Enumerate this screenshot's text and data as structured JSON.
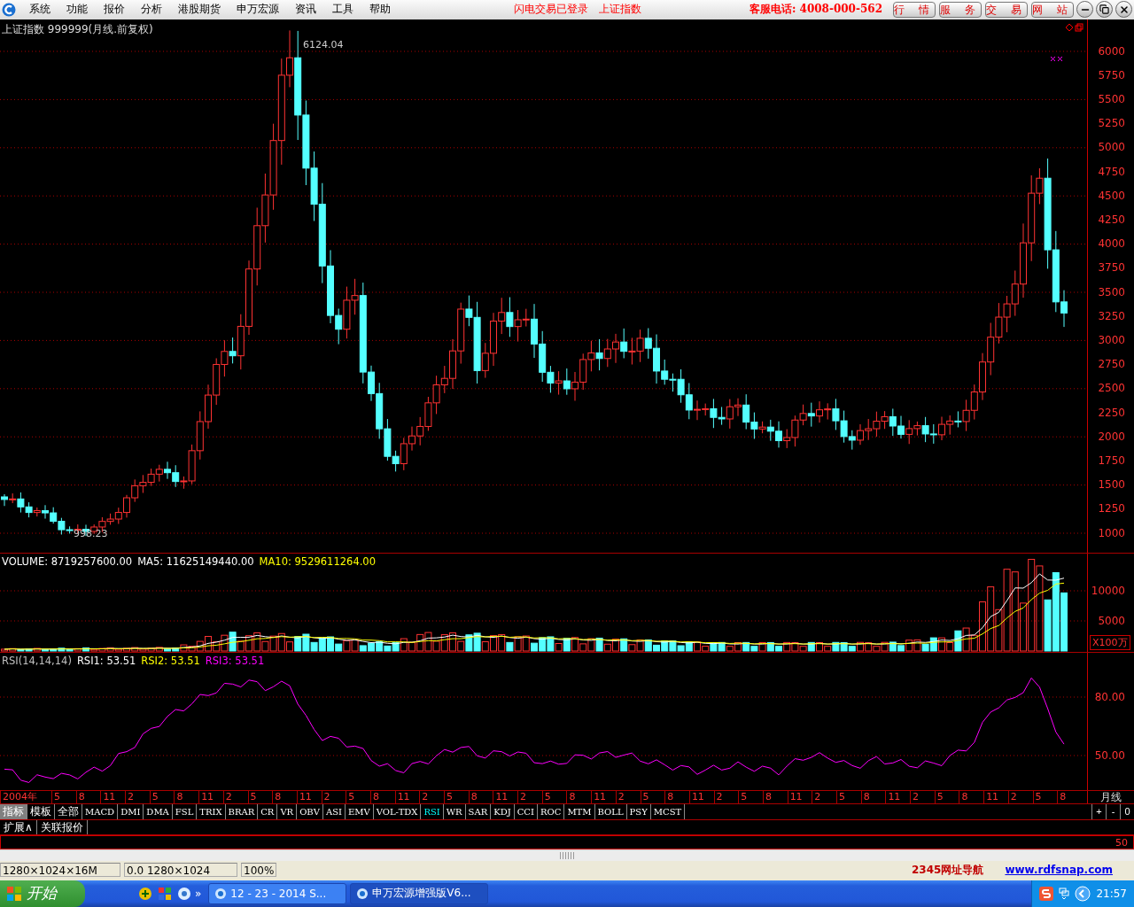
{
  "menu_bar": {
    "items": [
      "系统",
      "功能",
      "报价",
      "分析",
      "港股期货",
      "申万宏源",
      "资讯",
      "工具",
      "帮助"
    ],
    "login_status": "闪电交易已登录",
    "index_name": "上证指数",
    "hotline": "客服电话: 4008-000-562",
    "buttons": [
      "行 情",
      "服 务",
      "交 易",
      "网 站"
    ]
  },
  "price_panel": {
    "title": "上证指数 999999(月线.前复权)",
    "high_label": "6124.04",
    "low_label": "998.23",
    "axis": [
      "6000",
      "5750",
      "5500",
      "5250",
      "5000",
      "4750",
      "4500",
      "4250",
      "4000",
      "3750",
      "3500",
      "3250",
      "3000",
      "2750",
      "2500",
      "2250",
      "2000",
      "1750",
      "1500",
      "1250",
      "1000"
    ]
  },
  "volume_panel": {
    "legend": [
      {
        "text": "VOLUME: 8719257600.00",
        "color": "#ffffff"
      },
      {
        "text": "MA5: 11625149440.00",
        "color": "#ffffff"
      },
      {
        "text": "MA10: 9529611264.00",
        "color": "#ffff00"
      }
    ],
    "axis": [
      "10000",
      "5000"
    ],
    "unit": "X100万"
  },
  "rsi_panel": {
    "legend": [
      {
        "text": "RSI(14,14,14)",
        "color": "#c0c0c0"
      },
      {
        "text": "RSI1: 53.51",
        "color": "#ffffff"
      },
      {
        "text": "RSI2: 53.51",
        "color": "#ffff00"
      },
      {
        "text": "RSI3: 53.51",
        "color": "#ff00ff"
      }
    ],
    "axis": [
      "80.00",
      "50.00"
    ]
  },
  "date_axis": {
    "labels": [
      "2004年",
      "5",
      "8",
      "11",
      "2",
      "5",
      "8",
      "11",
      "2",
      "5",
      "8",
      "11",
      "2",
      "5",
      "8",
      "11",
      "2",
      "5",
      "8",
      "11",
      "2",
      "5",
      "8",
      "11",
      "2",
      "5",
      "8",
      "11",
      "2",
      "5",
      "8",
      "11",
      "2",
      "5",
      "8",
      "11",
      "2",
      "5",
      "8",
      "11",
      "2",
      "5",
      "8"
    ],
    "period": "月线"
  },
  "mode_tabs": [
    {
      "label": "指标",
      "selected": true
    },
    {
      "label": "模板",
      "selected": false
    },
    {
      "label": "全部",
      "selected": false
    }
  ],
  "indicator_tabs": [
    {
      "label": "MACD",
      "selected": false
    },
    {
      "label": "DMI",
      "selected": false
    },
    {
      "label": "DMA",
      "selected": false
    },
    {
      "label": "FSL",
      "selected": false
    },
    {
      "label": "TRIX",
      "selected": false
    },
    {
      "label": "BRAR",
      "selected": false
    },
    {
      "label": "CR",
      "selected": false
    },
    {
      "label": "VR",
      "selected": false
    },
    {
      "label": "OBV",
      "selected": false
    },
    {
      "label": "ASI",
      "selected": false
    },
    {
      "label": "EMV",
      "selected": false
    },
    {
      "label": "VOL-TDX",
      "selected": false
    },
    {
      "label": "RSI",
      "selected": true
    },
    {
      "label": "WR",
      "selected": false
    },
    {
      "label": "SAR",
      "selected": false
    },
    {
      "label": "KDJ",
      "selected": false
    },
    {
      "label": "CCI",
      "selected": false
    },
    {
      "label": "ROC",
      "selected": false
    },
    {
      "label": "MTM",
      "selected": false
    },
    {
      "label": "BOLL",
      "selected": false
    },
    {
      "label": "PSY",
      "selected": false
    },
    {
      "label": "MCST",
      "selected": false
    }
  ],
  "zoom_controls": [
    "+",
    "-",
    "0"
  ],
  "extension_tabs": [
    "扩展∧",
    "关联报价"
  ],
  "mini_panel": {
    "axis_label": "50"
  },
  "status_bar": {
    "fields": [
      "1280×1024×16M",
      "0.0 1280×1024",
      "100%"
    ],
    "links": [
      "2345网址导航",
      "www.rdfsnap.com"
    ]
  },
  "taskbar": {
    "start": "开始",
    "overflow": "»",
    "tasks": [
      {
        "label": "12 - 23 - 2014 S...",
        "selected": false
      },
      {
        "label": "申万宏源增强版V6...",
        "selected": true
      }
    ],
    "clock": "21:57"
  }
}
